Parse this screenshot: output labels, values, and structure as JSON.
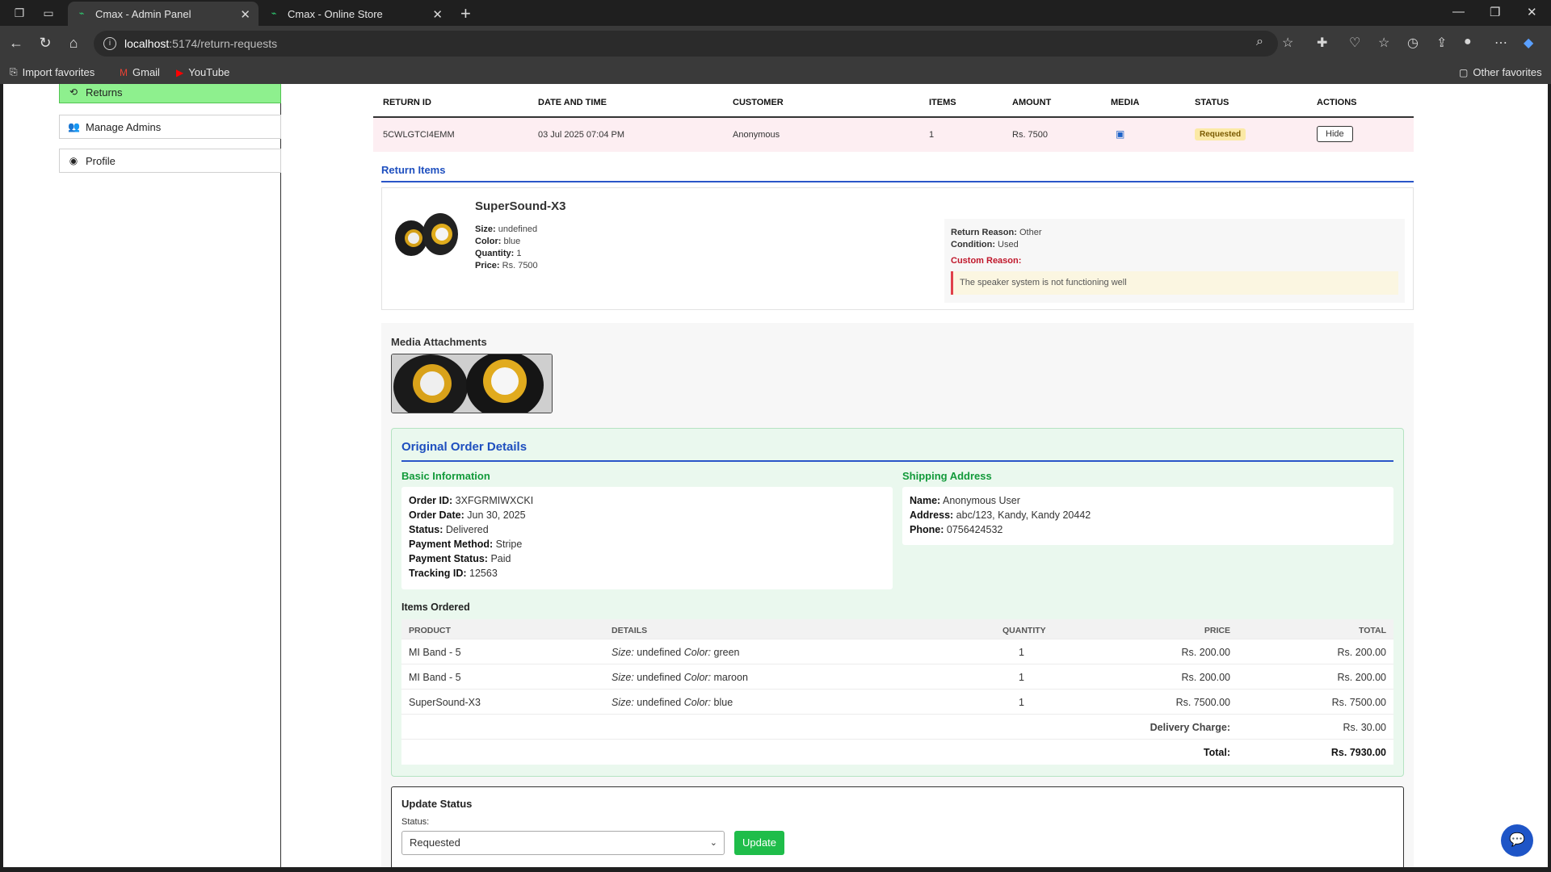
{
  "browser": {
    "tabs": [
      {
        "title": "Cmax - Admin Panel",
        "active": true
      },
      {
        "title": "Cmax - Online Store",
        "active": false
      }
    ],
    "url_host": "localhost",
    "url_path": ":5174/return-requests",
    "favorites": [
      {
        "label": "Import favorites",
        "icon": "import-icon"
      },
      {
        "label": "Gmail",
        "icon": "gmail-icon"
      },
      {
        "label": "YouTube",
        "icon": "youtube-icon"
      }
    ],
    "other_favorites": "Other favorites"
  },
  "sidebar": {
    "items": [
      {
        "label": "Returns",
        "icon": "returns-icon",
        "active": true
      },
      {
        "label": "Manage Admins",
        "icon": "users-icon",
        "active": false
      },
      {
        "label": "Profile",
        "icon": "user-circle-icon",
        "active": false
      }
    ]
  },
  "returns_table": {
    "headers": [
      "RETURN ID",
      "DATE AND TIME",
      "CUSTOMER",
      "ITEMS",
      "AMOUNT",
      "MEDIA",
      "STATUS",
      "ACTIONS"
    ],
    "row": {
      "return_id": "5CWLGTCI4EMM",
      "date_time": "03 Jul 2025 07:04 PM",
      "customer": "Anonymous",
      "items": "1",
      "amount": "Rs. 7500",
      "media_icon": "image-icon",
      "status": "Requested",
      "action": "Hide"
    }
  },
  "return_items": {
    "title": "Return Items",
    "product": {
      "name": "SuperSound-X3",
      "size_label": "Size:",
      "size": "undefined",
      "color_label": "Color:",
      "color": "blue",
      "quantity_label": "Quantity:",
      "quantity": "1",
      "price_label": "Price:",
      "price": "Rs. 7500"
    },
    "reason": {
      "reason_label": "Return Reason:",
      "reason": "Other",
      "condition_label": "Condition:",
      "condition": "Used",
      "custom_label": "Custom Reason:",
      "custom_text": "The speaker system is not functioning well"
    }
  },
  "media": {
    "title": "Media Attachments"
  },
  "order": {
    "title": "Original Order Details",
    "basic_title": "Basic Information",
    "basic": [
      {
        "label": "Order ID:",
        "value": "3XFGRMIWXCKI"
      },
      {
        "label": "Order Date:",
        "value": "Jun 30, 2025"
      },
      {
        "label": "Status:",
        "value": "Delivered"
      },
      {
        "label": "Payment Method:",
        "value": "Stripe"
      },
      {
        "label": "Payment Status:",
        "value": "Paid"
      },
      {
        "label": "Tracking ID:",
        "value": "12563"
      }
    ],
    "shipping_title": "Shipping Address",
    "shipping": [
      {
        "label": "Name:",
        "value": "Anonymous User"
      },
      {
        "label": "Address:",
        "value": "abc/123, Kandy, Kandy 20442"
      },
      {
        "label": "Phone:",
        "value": "0756424532"
      }
    ],
    "items_title": "Items Ordered",
    "items_headers": [
      "PRODUCT",
      "DETAILS",
      "QUANTITY",
      "PRICE",
      "TOTAL"
    ],
    "items": [
      {
        "product": "MI Band - 5",
        "size_label": "Size:",
        "size": "undefined",
        "color_label": "Color:",
        "color": "green",
        "quantity": "1",
        "price": "Rs. 200.00",
        "total": "Rs. 200.00"
      },
      {
        "product": "MI Band - 5",
        "size_label": "Size:",
        "size": "undefined",
        "color_label": "Color:",
        "color": "maroon",
        "quantity": "1",
        "price": "Rs. 200.00",
        "total": "Rs. 200.00"
      },
      {
        "product": "SuperSound-X3",
        "size_label": "Size:",
        "size": "undefined",
        "color_label": "Color:",
        "color": "blue",
        "quantity": "1",
        "price": "Rs. 7500.00",
        "total": "Rs. 7500.00"
      }
    ],
    "delivery_label": "Delivery Charge:",
    "delivery_value": "Rs. 30.00",
    "total_label": "Total:",
    "total_value": "Rs. 7930.00"
  },
  "update_status": {
    "title": "Update Status",
    "label": "Status:",
    "selected": "Requested",
    "button": "Update"
  },
  "colors": {
    "active_sidebar": "#8ef08e",
    "accent_blue": "#1e4fbf",
    "accent_green": "#1fbd4a",
    "row_highlight": "#fdeef2"
  }
}
